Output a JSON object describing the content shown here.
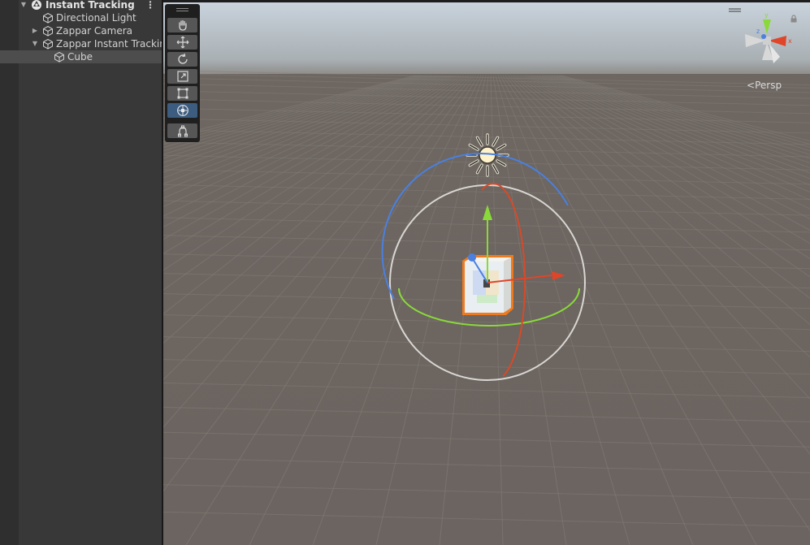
{
  "hierarchy": {
    "items": [
      {
        "label": "Instant Tracking",
        "icon": "unity-scene-icon",
        "expanded": true
      },
      {
        "label": "Directional Light",
        "icon": "gameobject-cube-icon"
      },
      {
        "label": "Zappar Camera",
        "icon": "gameobject-cube-icon",
        "expanded": false
      },
      {
        "label": "Zappar Instant Tracking",
        "icon": "gameobject-cube-icon",
        "expanded": true
      },
      {
        "label": "Cube",
        "icon": "gameobject-cube-icon",
        "selected": true
      }
    ],
    "menu_icon": "kebab-menu-icon"
  },
  "scene": {
    "tools": [
      {
        "name": "hand-tool",
        "icon": "hand-icon"
      },
      {
        "name": "move-tool",
        "icon": "move-arrows-icon"
      },
      {
        "name": "rotate-tool",
        "icon": "rotate-icon"
      },
      {
        "name": "scale-tool",
        "icon": "scale-icon"
      },
      {
        "name": "rect-tool",
        "icon": "rect-transform-icon"
      },
      {
        "name": "transform-tool",
        "icon": "transform-all-icon",
        "active": true
      },
      {
        "name": "custom-tool",
        "icon": "custom-editor-tool-icon"
      }
    ],
    "gizmo": {
      "projection_label": "Persp",
      "axes": [
        "y",
        "x",
        "z"
      ]
    },
    "colors": {
      "sky": "#b9c1c8",
      "ground": "#6f6661",
      "grid": "#858080",
      "x_axis": "#e0452a",
      "y_axis": "#8ad93a",
      "z_axis": "#4a80e0",
      "selection_outline": "#f07a1e",
      "toolbar_active": "#3c5c80"
    }
  }
}
